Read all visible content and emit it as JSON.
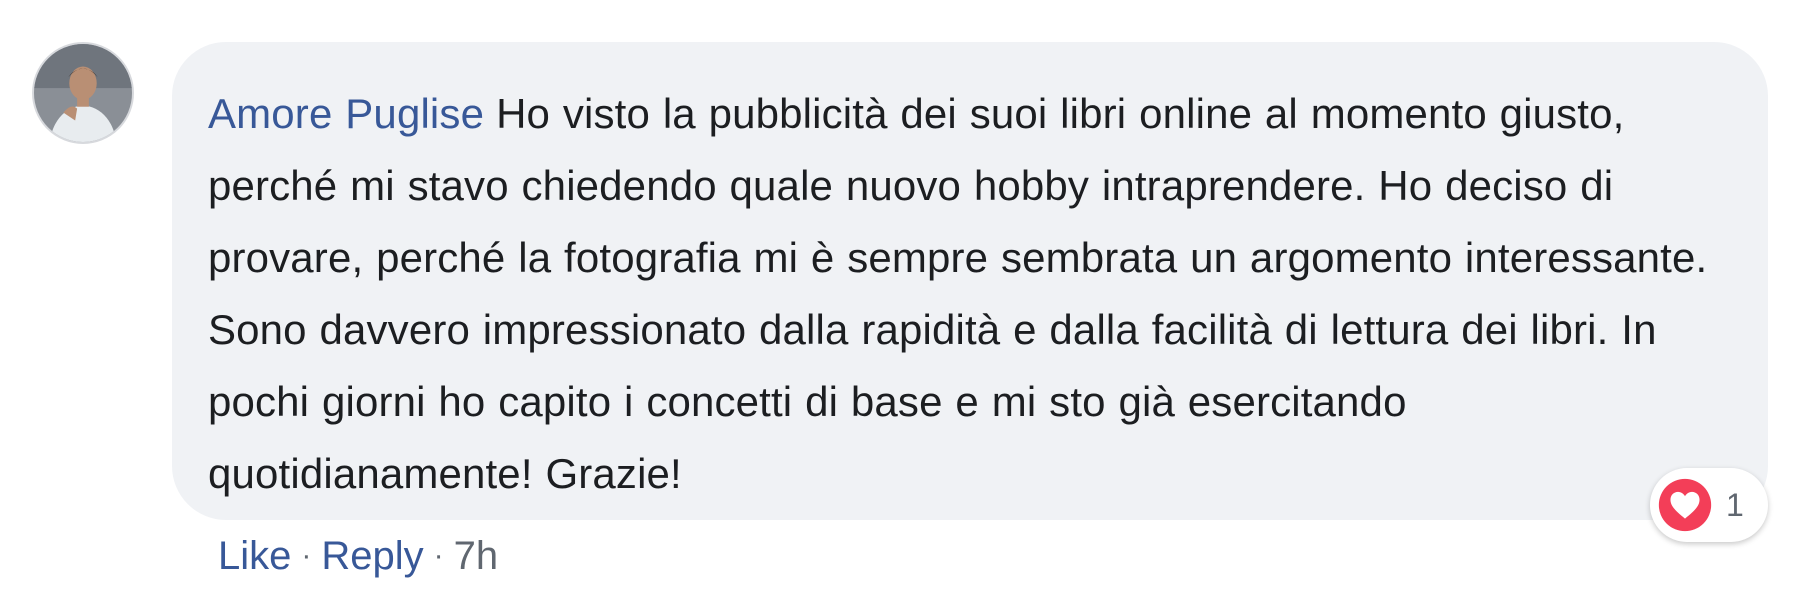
{
  "comment": {
    "author": "Amore Puglise",
    "text": "Ho visto la pubblicità dei suoi libri online al momento giusto, perché mi stavo chiedendo quale nuovo hobby intraprendere. Ho deciso di provare, perché la fotografia mi è sempre sembrata un argomento interessante. Sono davvero impressionato dalla rapidità e dalla facilità di lettura dei libri. In pochi giorni ho capito i concetti di base e mi sto già esercitando quotidianamente! Grazie!",
    "reaction": {
      "icon": "heart-icon",
      "count": "1",
      "color": "#f33e58"
    },
    "actions": {
      "like": "Like",
      "separator": "·",
      "reply": "Reply",
      "time": "7h"
    }
  },
  "colors": {
    "link": "#385898",
    "bubble": "#f0f2f5",
    "text": "#1c1e21",
    "meta": "#606770"
  }
}
